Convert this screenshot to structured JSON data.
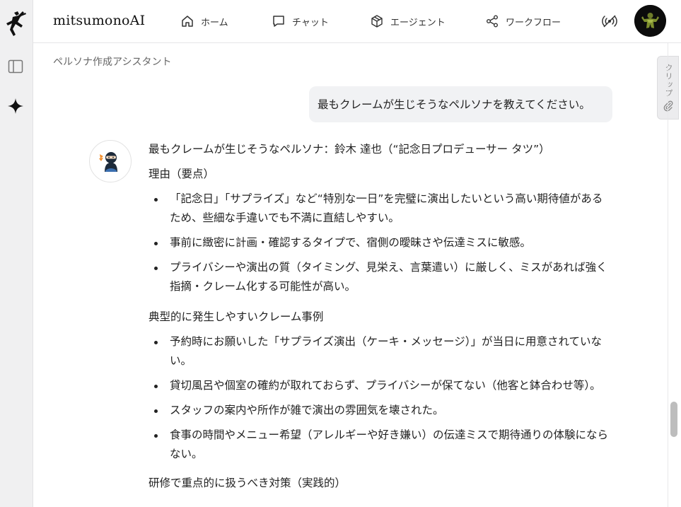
{
  "header": {
    "brand": "mitsumonoAI",
    "nav": [
      {
        "label": "ホーム",
        "icon": "home-icon"
      },
      {
        "label": "チャット",
        "icon": "chat-icon"
      },
      {
        "label": "エージェント",
        "icon": "agent-cube-icon"
      },
      {
        "label": "ワークフロー",
        "icon": "share-nodes-icon"
      }
    ]
  },
  "breadcrumb": "ペルソナ作成アシスタント",
  "clip_tab": {
    "label": "クリップ"
  },
  "conversation": {
    "user_message": "最もクレームが生じそうなペルソナを教えてください。",
    "answer": {
      "headline": "最もクレームが生じそうなペルソナ：鈴木 達也（“記念日プロデューサー タツ”）",
      "reasons_heading": "理由（要点）",
      "reasons": [
        "「記念日」「サプライズ」など“特別な一日”を完璧に演出したいという高い期待値があるため、些細な手違いでも不満に直結しやすい。",
        "事前に緻密に計画・確認するタイプで、宿側の曖昧さや伝達ミスに敏感。",
        "プライバシーや演出の質（タイミング、見栄え、言葉遣い）に厳しく、ミスがあれば強く指摘・クレーム化する可能性が高い。"
      ],
      "cases_heading": "典型的に発生しやすいクレーム事例",
      "cases": [
        "予約時にお願いした「サプライズ演出（ケーキ・メッセージ）」が当日に用意されていない。",
        "貸切風呂や個室の確約が取れておらず、プライバシーが保てない（他客と鉢合わせ等）。",
        "スタッフの案内や所作が雑で演出の雰囲気を壊された。",
        "食事の時間やメニュー希望（アレルギーや好き嫌い）の伝達ミスで期待通りの体験にならない。"
      ],
      "next_heading": "研修で重点的に扱うべき対策（実践的）"
    }
  },
  "colors": {
    "rail_bg": "#f0f0f1",
    "bubble_bg": "#f1f2f4",
    "text": "#222222"
  }
}
